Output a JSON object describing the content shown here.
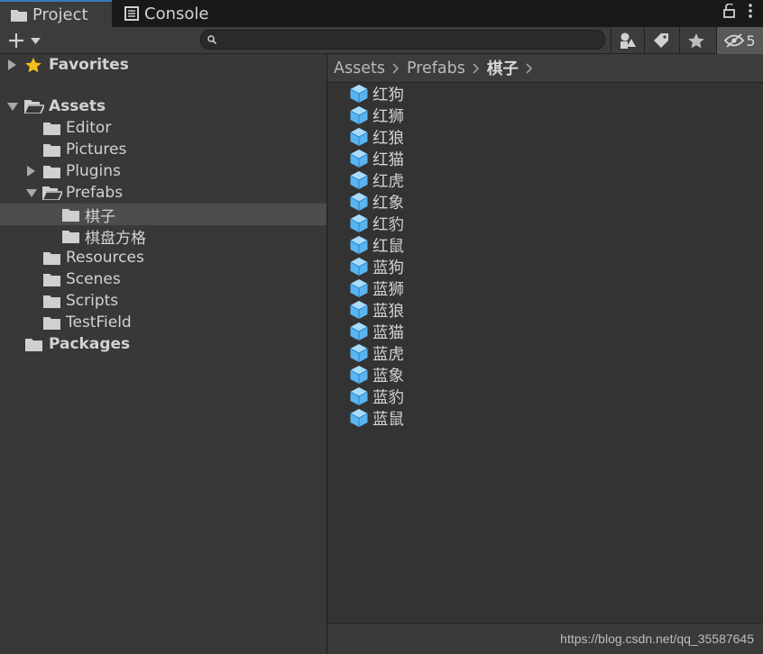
{
  "tabs": [
    {
      "label": "Project",
      "icon": "folder-icon",
      "active": true
    },
    {
      "label": "Console",
      "icon": "console-icon",
      "active": false
    }
  ],
  "toolbar": {
    "add_label": "+",
    "search_value": "",
    "search_placeholder": "",
    "hidden_packages_count": "5"
  },
  "tree": [
    {
      "label": "Favorites",
      "icon": "star-icon",
      "bold": true,
      "arrow": "right"
    },
    {
      "label": "Assets",
      "icon": "folder-open-icon",
      "bold": true,
      "arrow": "down"
    },
    {
      "label": "Editor",
      "icon": "folder-icon",
      "bold": false,
      "arrow": "none"
    },
    {
      "label": "Pictures",
      "icon": "folder-icon",
      "bold": false,
      "arrow": "none"
    },
    {
      "label": "Plugins",
      "icon": "folder-icon",
      "bold": false,
      "arrow": "right"
    },
    {
      "label": "Prefabs",
      "icon": "folder-open-icon",
      "bold": false,
      "arrow": "down"
    },
    {
      "label": "棋子",
      "icon": "folder-icon",
      "bold": false,
      "arrow": "none",
      "selected": true
    },
    {
      "label": "棋盘方格",
      "icon": "folder-icon",
      "bold": false,
      "arrow": "none"
    },
    {
      "label": "Resources",
      "icon": "folder-icon",
      "bold": false,
      "arrow": "none"
    },
    {
      "label": "Scenes",
      "icon": "folder-icon",
      "bold": false,
      "arrow": "none"
    },
    {
      "label": "Scripts",
      "icon": "folder-icon",
      "bold": false,
      "arrow": "none"
    },
    {
      "label": "TestField",
      "icon": "folder-icon",
      "bold": false,
      "arrow": "none"
    },
    {
      "label": "Packages",
      "icon": "folder-icon",
      "bold": true,
      "arrow": "none"
    }
  ],
  "breadcrumb": [
    "Assets",
    "Prefabs",
    "棋子"
  ],
  "files": [
    {
      "name": "红狗",
      "icon": "prefab-cube-icon"
    },
    {
      "name": "红狮",
      "icon": "prefab-cube-icon"
    },
    {
      "name": "红狼",
      "icon": "prefab-cube-icon"
    },
    {
      "name": "红猫",
      "icon": "prefab-cube-icon"
    },
    {
      "name": "红虎",
      "icon": "prefab-cube-icon"
    },
    {
      "name": "红象",
      "icon": "prefab-cube-icon"
    },
    {
      "name": "红豹",
      "icon": "prefab-cube-icon"
    },
    {
      "name": "红鼠",
      "icon": "prefab-cube-icon"
    },
    {
      "name": "蓝狗",
      "icon": "prefab-cube-icon"
    },
    {
      "name": "蓝狮",
      "icon": "prefab-cube-icon"
    },
    {
      "name": "蓝狼",
      "icon": "prefab-cube-icon"
    },
    {
      "name": "蓝猫",
      "icon": "prefab-cube-icon"
    },
    {
      "name": "蓝虎",
      "icon": "prefab-cube-icon"
    },
    {
      "name": "蓝象",
      "icon": "prefab-cube-icon"
    },
    {
      "name": "蓝豹",
      "icon": "prefab-cube-icon"
    },
    {
      "name": "蓝鼠",
      "icon": "prefab-cube-icon"
    }
  ],
  "watermark": "https://blog.csdn.net/qq_35587645",
  "colors": {
    "accent_tab": "#3a79bb",
    "prefab_blue": "#5ab4f0",
    "star_gold": "#f4c01e",
    "selection": "#4d4d4d"
  }
}
